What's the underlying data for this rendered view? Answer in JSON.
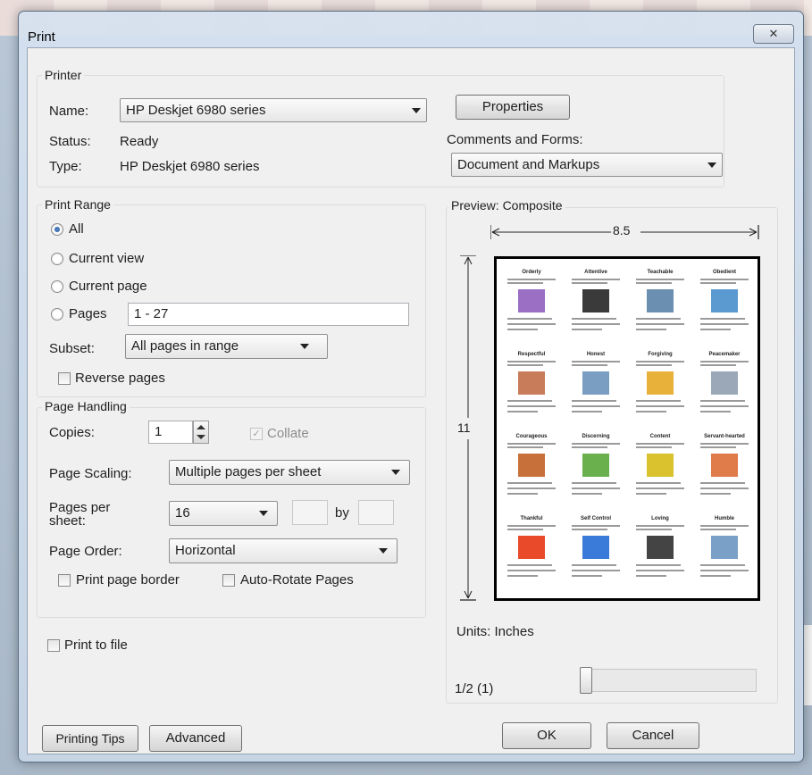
{
  "window": {
    "title": "Print",
    "close_symbol": "✕"
  },
  "printer": {
    "legend": "Printer",
    "name_label": "Name:",
    "name_value": "HP Deskjet 6980 series",
    "status_label": "Status:",
    "status_value": "Ready",
    "type_label": "Type:",
    "type_value": "HP Deskjet 6980 series",
    "properties_label": "Properties",
    "comments_label": "Comments and Forms:",
    "comments_value": "Document and Markups"
  },
  "print_range": {
    "legend": "Print Range",
    "options": [
      "All",
      "Current view",
      "Current page",
      "Pages"
    ],
    "selected": "All",
    "pages_value": "1 - 27",
    "subset_label": "Subset:",
    "subset_value": "All pages in range",
    "reverse_label": "Reverse pages"
  },
  "page_handling": {
    "legend": "Page Handling",
    "copies_label": "Copies:",
    "copies_value": "1",
    "collate_label": "Collate",
    "scaling_label": "Page Scaling:",
    "scaling_value": "Multiple pages per sheet",
    "per_sheet_label": "Pages per sheet:",
    "per_sheet_value": "16",
    "by_label": "by",
    "order_label": "Page Order:",
    "order_value": "Horizontal",
    "border_label": "Print page border",
    "autorotate_label": "Auto-Rotate Pages"
  },
  "print_to_file_label": "Print to file",
  "preview": {
    "label": "Preview: Composite",
    "width_value": "8.5",
    "height_value": "11",
    "units_label": "Units: Inches",
    "page_indicator": "1/2 (1)",
    "tiles": [
      "Orderly",
      "Attentive",
      "Teachable",
      "Obedient",
      "Respectful",
      "Honest",
      "Forgiving",
      "Peacemaker",
      "Courageous",
      "Discerning",
      "Content",
      "Servant-hearted",
      "Thankful",
      "Self Control",
      "Loving",
      "Humble"
    ]
  },
  "buttons": {
    "tips": "Printing Tips",
    "advanced": "Advanced",
    "ok": "OK",
    "cancel": "Cancel"
  },
  "colors": {
    "tile_pics": [
      "#9b6fc4",
      "#3a3a3a",
      "#6a8fb0",
      "#5a9ad0",
      "#c87c5a",
      "#7a9ec2",
      "#e8b23a",
      "#9aa8b8",
      "#c8703a",
      "#6ab04c",
      "#d9c22e",
      "#e07b4a",
      "#e84a2a",
      "#3a7ad8",
      "#444444",
      "#7aa0c8"
    ]
  }
}
